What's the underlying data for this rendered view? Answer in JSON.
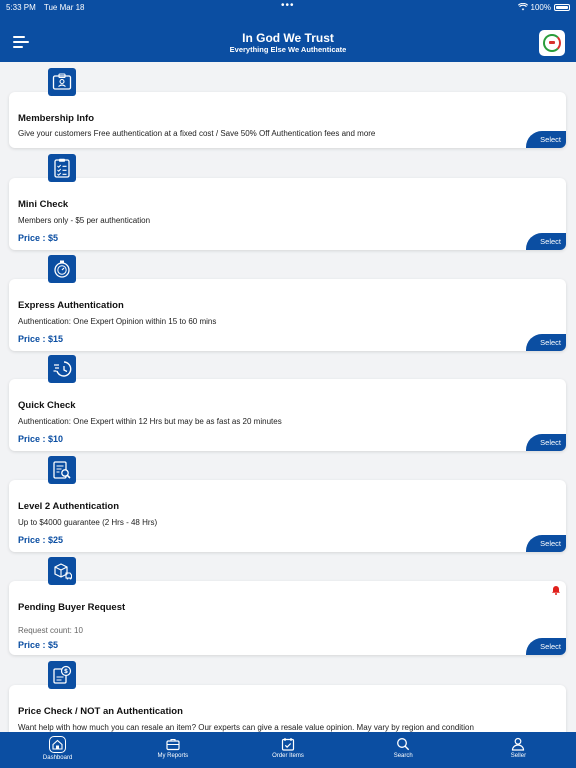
{
  "status_bar": {
    "time": "5:33 PM",
    "date": "Tue Mar 18",
    "battery": "100%"
  },
  "header": {
    "title": "In God We Trust",
    "subtitle": "Everything Else We Authenticate"
  },
  "cards": [
    {
      "icon": "membership-card-icon",
      "title": "Membership Info",
      "description": "Give your customers Free authentication at a fixed cost / Save 50% Off Authentication fees and more",
      "price": "",
      "select_label": "Select"
    },
    {
      "icon": "checklist-icon",
      "title": "Mini Check",
      "description": "Members only - $5 per authentication",
      "price": "Price : $5",
      "select_label": "Select"
    },
    {
      "icon": "stopwatch-icon",
      "title": "Express Authentication",
      "description": "Authentication: One Expert Opinion within 15 to 60 mins",
      "price": "Price : $15",
      "select_label": "Select"
    },
    {
      "icon": "fast-clock-icon",
      "title": "Quick Check",
      "description": "Authentication: One Expert within 12 Hrs but may be as fast as 20 minutes",
      "price": "Price : $10",
      "select_label": "Select"
    },
    {
      "icon": "document-search-icon",
      "title": "Level 2 Authentication",
      "description": "Up to $4000 guarantee (2 Hrs - 48 Hrs)",
      "price": "Price : $25",
      "select_label": "Select"
    },
    {
      "icon": "package-icon",
      "title": "Pending Buyer Request",
      "description": "Request count: 10",
      "price": "Price : $5",
      "select_label": "Select",
      "badge_icon": "bell-icon"
    },
    {
      "icon": "price-tag-document-icon",
      "title": "Price Check / NOT an Authentication",
      "description": "Want help with how much you can resale an item? Our experts can give a resale value opinion. May vary by region and condition",
      "price": "",
      "select_label": ""
    }
  ],
  "tabs": [
    {
      "label": "Dashboard",
      "icon": "home-icon",
      "active": true
    },
    {
      "label": "My Reports",
      "icon": "briefcase-icon"
    },
    {
      "label": "Order Items",
      "icon": "calendar-check-icon"
    },
    {
      "label": "Search",
      "icon": "search-icon"
    },
    {
      "label": "Seller",
      "icon": "user-icon"
    }
  ],
  "colors": {
    "primary": "#0b4ea2",
    "background": "#f2f3f5",
    "alert": "#e0201c"
  }
}
